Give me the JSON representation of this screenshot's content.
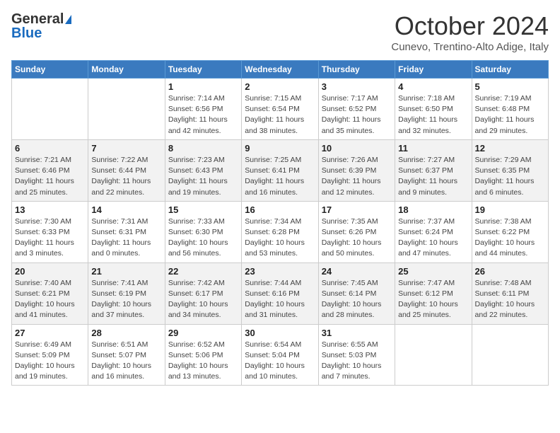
{
  "header": {
    "logo_general": "General",
    "logo_blue": "Blue",
    "month_title": "October 2024",
    "location": "Cunevo, Trentino-Alto Adige, Italy"
  },
  "days_of_week": [
    "Sunday",
    "Monday",
    "Tuesday",
    "Wednesday",
    "Thursday",
    "Friday",
    "Saturday"
  ],
  "weeks": [
    [
      {
        "day": "",
        "info": ""
      },
      {
        "day": "",
        "info": ""
      },
      {
        "day": "1",
        "info": "Sunrise: 7:14 AM\nSunset: 6:56 PM\nDaylight: 11 hours and 42 minutes."
      },
      {
        "day": "2",
        "info": "Sunrise: 7:15 AM\nSunset: 6:54 PM\nDaylight: 11 hours and 38 minutes."
      },
      {
        "day": "3",
        "info": "Sunrise: 7:17 AM\nSunset: 6:52 PM\nDaylight: 11 hours and 35 minutes."
      },
      {
        "day": "4",
        "info": "Sunrise: 7:18 AM\nSunset: 6:50 PM\nDaylight: 11 hours and 32 minutes."
      },
      {
        "day": "5",
        "info": "Sunrise: 7:19 AM\nSunset: 6:48 PM\nDaylight: 11 hours and 29 minutes."
      }
    ],
    [
      {
        "day": "6",
        "info": "Sunrise: 7:21 AM\nSunset: 6:46 PM\nDaylight: 11 hours and 25 minutes."
      },
      {
        "day": "7",
        "info": "Sunrise: 7:22 AM\nSunset: 6:44 PM\nDaylight: 11 hours and 22 minutes."
      },
      {
        "day": "8",
        "info": "Sunrise: 7:23 AM\nSunset: 6:43 PM\nDaylight: 11 hours and 19 minutes."
      },
      {
        "day": "9",
        "info": "Sunrise: 7:25 AM\nSunset: 6:41 PM\nDaylight: 11 hours and 16 minutes."
      },
      {
        "day": "10",
        "info": "Sunrise: 7:26 AM\nSunset: 6:39 PM\nDaylight: 11 hours and 12 minutes."
      },
      {
        "day": "11",
        "info": "Sunrise: 7:27 AM\nSunset: 6:37 PM\nDaylight: 11 hours and 9 minutes."
      },
      {
        "day": "12",
        "info": "Sunrise: 7:29 AM\nSunset: 6:35 PM\nDaylight: 11 hours and 6 minutes."
      }
    ],
    [
      {
        "day": "13",
        "info": "Sunrise: 7:30 AM\nSunset: 6:33 PM\nDaylight: 11 hours and 3 minutes."
      },
      {
        "day": "14",
        "info": "Sunrise: 7:31 AM\nSunset: 6:31 PM\nDaylight: 11 hours and 0 minutes."
      },
      {
        "day": "15",
        "info": "Sunrise: 7:33 AM\nSunset: 6:30 PM\nDaylight: 10 hours and 56 minutes."
      },
      {
        "day": "16",
        "info": "Sunrise: 7:34 AM\nSunset: 6:28 PM\nDaylight: 10 hours and 53 minutes."
      },
      {
        "day": "17",
        "info": "Sunrise: 7:35 AM\nSunset: 6:26 PM\nDaylight: 10 hours and 50 minutes."
      },
      {
        "day": "18",
        "info": "Sunrise: 7:37 AM\nSunset: 6:24 PM\nDaylight: 10 hours and 47 minutes."
      },
      {
        "day": "19",
        "info": "Sunrise: 7:38 AM\nSunset: 6:22 PM\nDaylight: 10 hours and 44 minutes."
      }
    ],
    [
      {
        "day": "20",
        "info": "Sunrise: 7:40 AM\nSunset: 6:21 PM\nDaylight: 10 hours and 41 minutes."
      },
      {
        "day": "21",
        "info": "Sunrise: 7:41 AM\nSunset: 6:19 PM\nDaylight: 10 hours and 37 minutes."
      },
      {
        "day": "22",
        "info": "Sunrise: 7:42 AM\nSunset: 6:17 PM\nDaylight: 10 hours and 34 minutes."
      },
      {
        "day": "23",
        "info": "Sunrise: 7:44 AM\nSunset: 6:16 PM\nDaylight: 10 hours and 31 minutes."
      },
      {
        "day": "24",
        "info": "Sunrise: 7:45 AM\nSunset: 6:14 PM\nDaylight: 10 hours and 28 minutes."
      },
      {
        "day": "25",
        "info": "Sunrise: 7:47 AM\nSunset: 6:12 PM\nDaylight: 10 hours and 25 minutes."
      },
      {
        "day": "26",
        "info": "Sunrise: 7:48 AM\nSunset: 6:11 PM\nDaylight: 10 hours and 22 minutes."
      }
    ],
    [
      {
        "day": "27",
        "info": "Sunrise: 6:49 AM\nSunset: 5:09 PM\nDaylight: 10 hours and 19 minutes."
      },
      {
        "day": "28",
        "info": "Sunrise: 6:51 AM\nSunset: 5:07 PM\nDaylight: 10 hours and 16 minutes."
      },
      {
        "day": "29",
        "info": "Sunrise: 6:52 AM\nSunset: 5:06 PM\nDaylight: 10 hours and 13 minutes."
      },
      {
        "day": "30",
        "info": "Sunrise: 6:54 AM\nSunset: 5:04 PM\nDaylight: 10 hours and 10 minutes."
      },
      {
        "day": "31",
        "info": "Sunrise: 6:55 AM\nSunset: 5:03 PM\nDaylight: 10 hours and 7 minutes."
      },
      {
        "day": "",
        "info": ""
      },
      {
        "day": "",
        "info": ""
      }
    ]
  ]
}
